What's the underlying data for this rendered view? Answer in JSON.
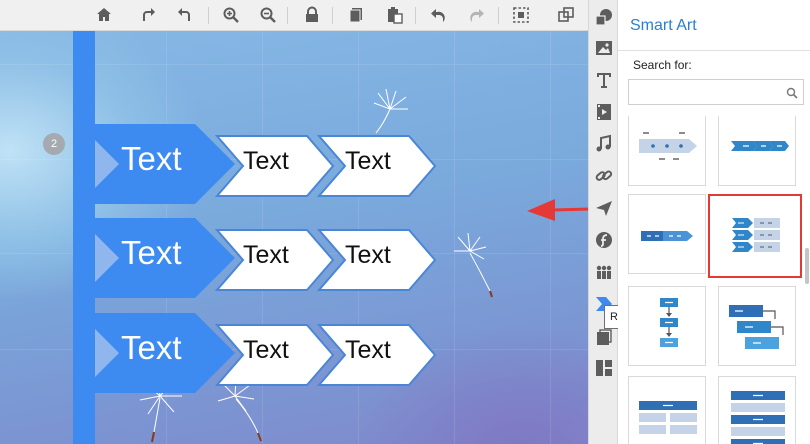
{
  "toolbar": {
    "buttons": [
      "home-icon",
      "redo-rotate-icon",
      "undo-rotate-icon",
      "zoom-in-icon",
      "zoom-out-icon",
      "lock-icon",
      "copy-icon",
      "paste-icon",
      "undo-icon",
      "redo-icon",
      "select-icon",
      "group-icon"
    ]
  },
  "canvas": {
    "slide_number": "2",
    "rows": [
      {
        "main": "Text",
        "items": [
          "Text",
          "Text"
        ]
      },
      {
        "main": "Text",
        "items": [
          "Text",
          "Text"
        ]
      },
      {
        "main": "Text",
        "items": [
          "Text",
          "Text"
        ]
      }
    ]
  },
  "iconbar": {
    "buttons": [
      "shapes-icon",
      "image-icon",
      "text-icon",
      "video-icon",
      "music-icon",
      "link-icon",
      "plane-icon",
      "flash-icon",
      "roles-icon",
      "smart-art-icon",
      "page-icon",
      "layout-icon"
    ],
    "tooltip": "Roles"
  },
  "panel": {
    "title": "Smart Art",
    "search_label": "Search for:",
    "search_value": "",
    "search_placeholder": ""
  },
  "colors": {
    "accent": "#2a7fd0",
    "chevron_blue": "#3d8af1",
    "highlight_red": "#e53935"
  }
}
